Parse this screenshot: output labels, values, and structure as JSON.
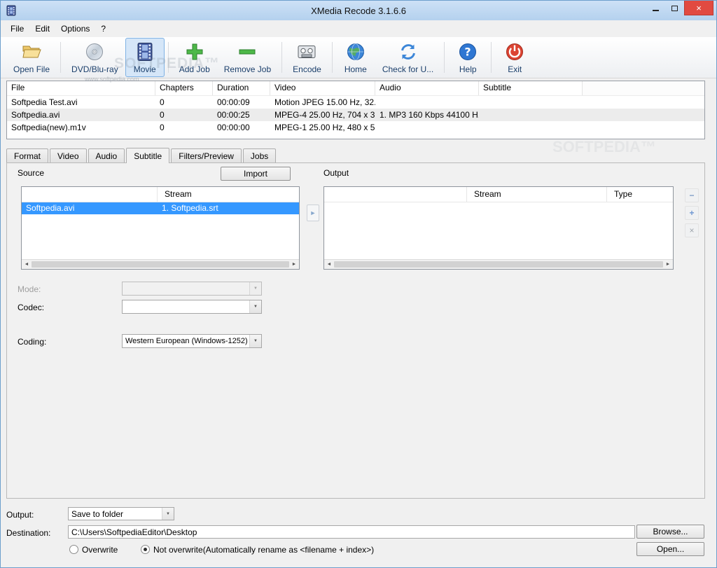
{
  "window": {
    "title": "XMedia Recode 3.1.6.6"
  },
  "watermark": {
    "brand": "SOFTPEDIA™",
    "url": "www.softpedia.com"
  },
  "icons": {
    "close": "×",
    "dropdown_arrow": "▼",
    "scroll_left": "◄",
    "scroll_right": "►",
    "transfer": "►",
    "stream_remove": "−",
    "stream_add": "+",
    "stream_delete": "×"
  },
  "menubar": {
    "items": [
      "File",
      "Edit",
      "Options",
      "?"
    ]
  },
  "toolbar": {
    "buttons": [
      {
        "label": "Open File",
        "icon": "open-file-icon"
      },
      {
        "label": "DVD/Blu-ray",
        "icon": "dvd-disc-icon"
      },
      {
        "label": "Movie",
        "icon": "movie-filmstrip-icon",
        "selected": true
      },
      {
        "label": "Add Job",
        "icon": "add-plus-icon"
      },
      {
        "label": "Remove Job",
        "icon": "remove-minus-icon"
      },
      {
        "label": "Encode",
        "icon": "encode-cassette-icon"
      },
      {
        "label": "Home",
        "icon": "home-globe-icon"
      },
      {
        "label": "Check for U...",
        "icon": "check-updates-icon"
      },
      {
        "label": "Help",
        "icon": "help-question-icon"
      },
      {
        "label": "Exit",
        "icon": "exit-power-icon"
      }
    ]
  },
  "file_table": {
    "columns": [
      "File",
      "Chapters",
      "Duration",
      "Video",
      "Audio",
      "Subtitle"
    ],
    "rows": [
      {
        "file": "Softpedia Test.avi",
        "chapters": "0",
        "duration": "00:00:09",
        "video": "Motion JPEG 15.00 Hz, 32...",
        "audio": "",
        "subtitle": ""
      },
      {
        "file": "Softpedia.avi",
        "chapters": "0",
        "duration": "00:00:25",
        "video": "MPEG-4 25.00 Hz, 704 x 3...",
        "audio": "1. MP3 160 Kbps 44100 H...",
        "subtitle": ""
      },
      {
        "file": "Softpedia(new).m1v",
        "chapters": "0",
        "duration": "00:00:00",
        "video": "MPEG-1 25.00 Hz, 480 x 5...",
        "audio": "",
        "subtitle": ""
      }
    ]
  },
  "tabs": {
    "items": [
      "Format",
      "Video",
      "Audio",
      "Subtitle",
      "Filters/Preview",
      "Jobs"
    ],
    "active": "Subtitle"
  },
  "subtitle_tab": {
    "source_label": "Source",
    "import_button": "Import",
    "output_label": "Output",
    "source_table": {
      "stream_header": "Stream",
      "selected_row": {
        "file": "Softpedia.avi",
        "stream": "1. Softpedia.srt"
      }
    },
    "output_table": {
      "stream_header": "Stream",
      "type_header": "Type"
    },
    "mode_label": "Mode:",
    "codec_label": "Codec:",
    "codec_value": "",
    "coding_label": "Coding:",
    "coding_value": "Western European (Windows-1252)"
  },
  "bottom_bar": {
    "output_label": "Output:",
    "output_value": "Save to folder",
    "destination_label": "Destination:",
    "destination_value": "C:\\Users\\SoftpediaEditor\\Desktop",
    "browse_button": "Browse...",
    "open_button": "Open...",
    "overwrite_option": "Overwrite",
    "not_overwrite_option": "Not overwrite(Automatically rename as <filename + index>)"
  }
}
